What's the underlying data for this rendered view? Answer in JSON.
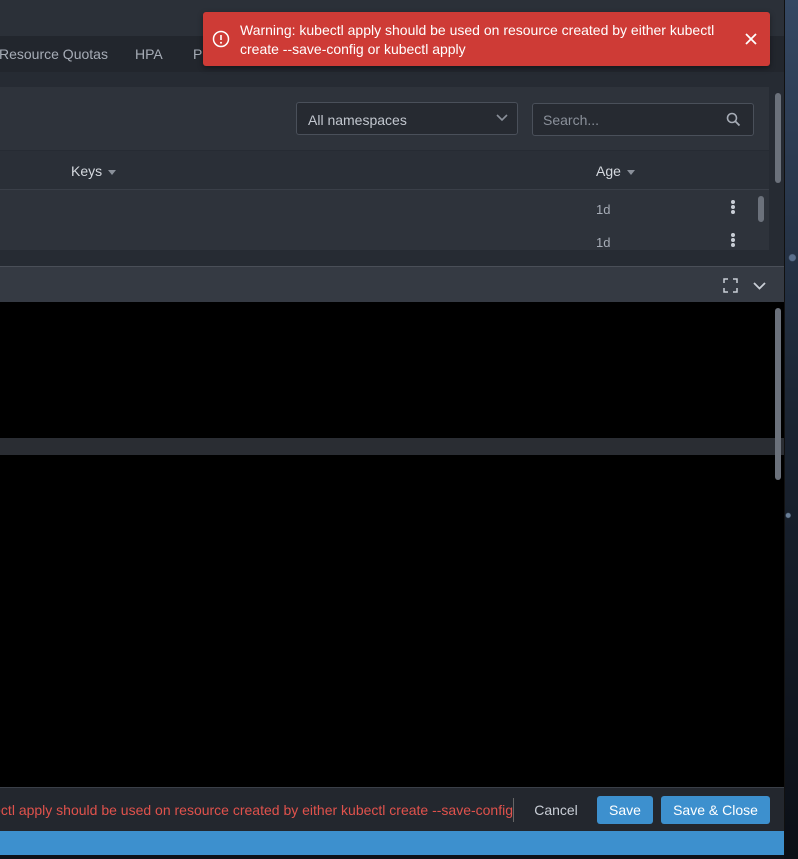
{
  "tabs": [
    "Resource Quotas",
    "HPA",
    "P"
  ],
  "namespace_select": {
    "value": "All namespaces"
  },
  "search": {
    "placeholder": "Search..."
  },
  "table": {
    "columns": [
      "Keys",
      "Age"
    ],
    "rows": [
      {
        "age": "1d"
      },
      {
        "age": "1d"
      }
    ]
  },
  "footer": {
    "error_text": "Warning: kubectl apply should be used on resource created by either kubectl create --save-config",
    "cancel_label": "Cancel",
    "save_label": "Save",
    "save_close_label": "Save & Close"
  },
  "toast": {
    "message": "Warning: kubectl apply should be used on resource created by either kubectl create --save-config or kubectl apply"
  },
  "icons": [
    "chevron-down-icon",
    "search-icon",
    "more-vertical-icon",
    "fullscreen-icon",
    "collapse-icon",
    "info-icon",
    "close-icon"
  ],
  "colors": {
    "accent": "#3d90ce",
    "error": "#ce3b36",
    "error_text": "#e0524c"
  }
}
